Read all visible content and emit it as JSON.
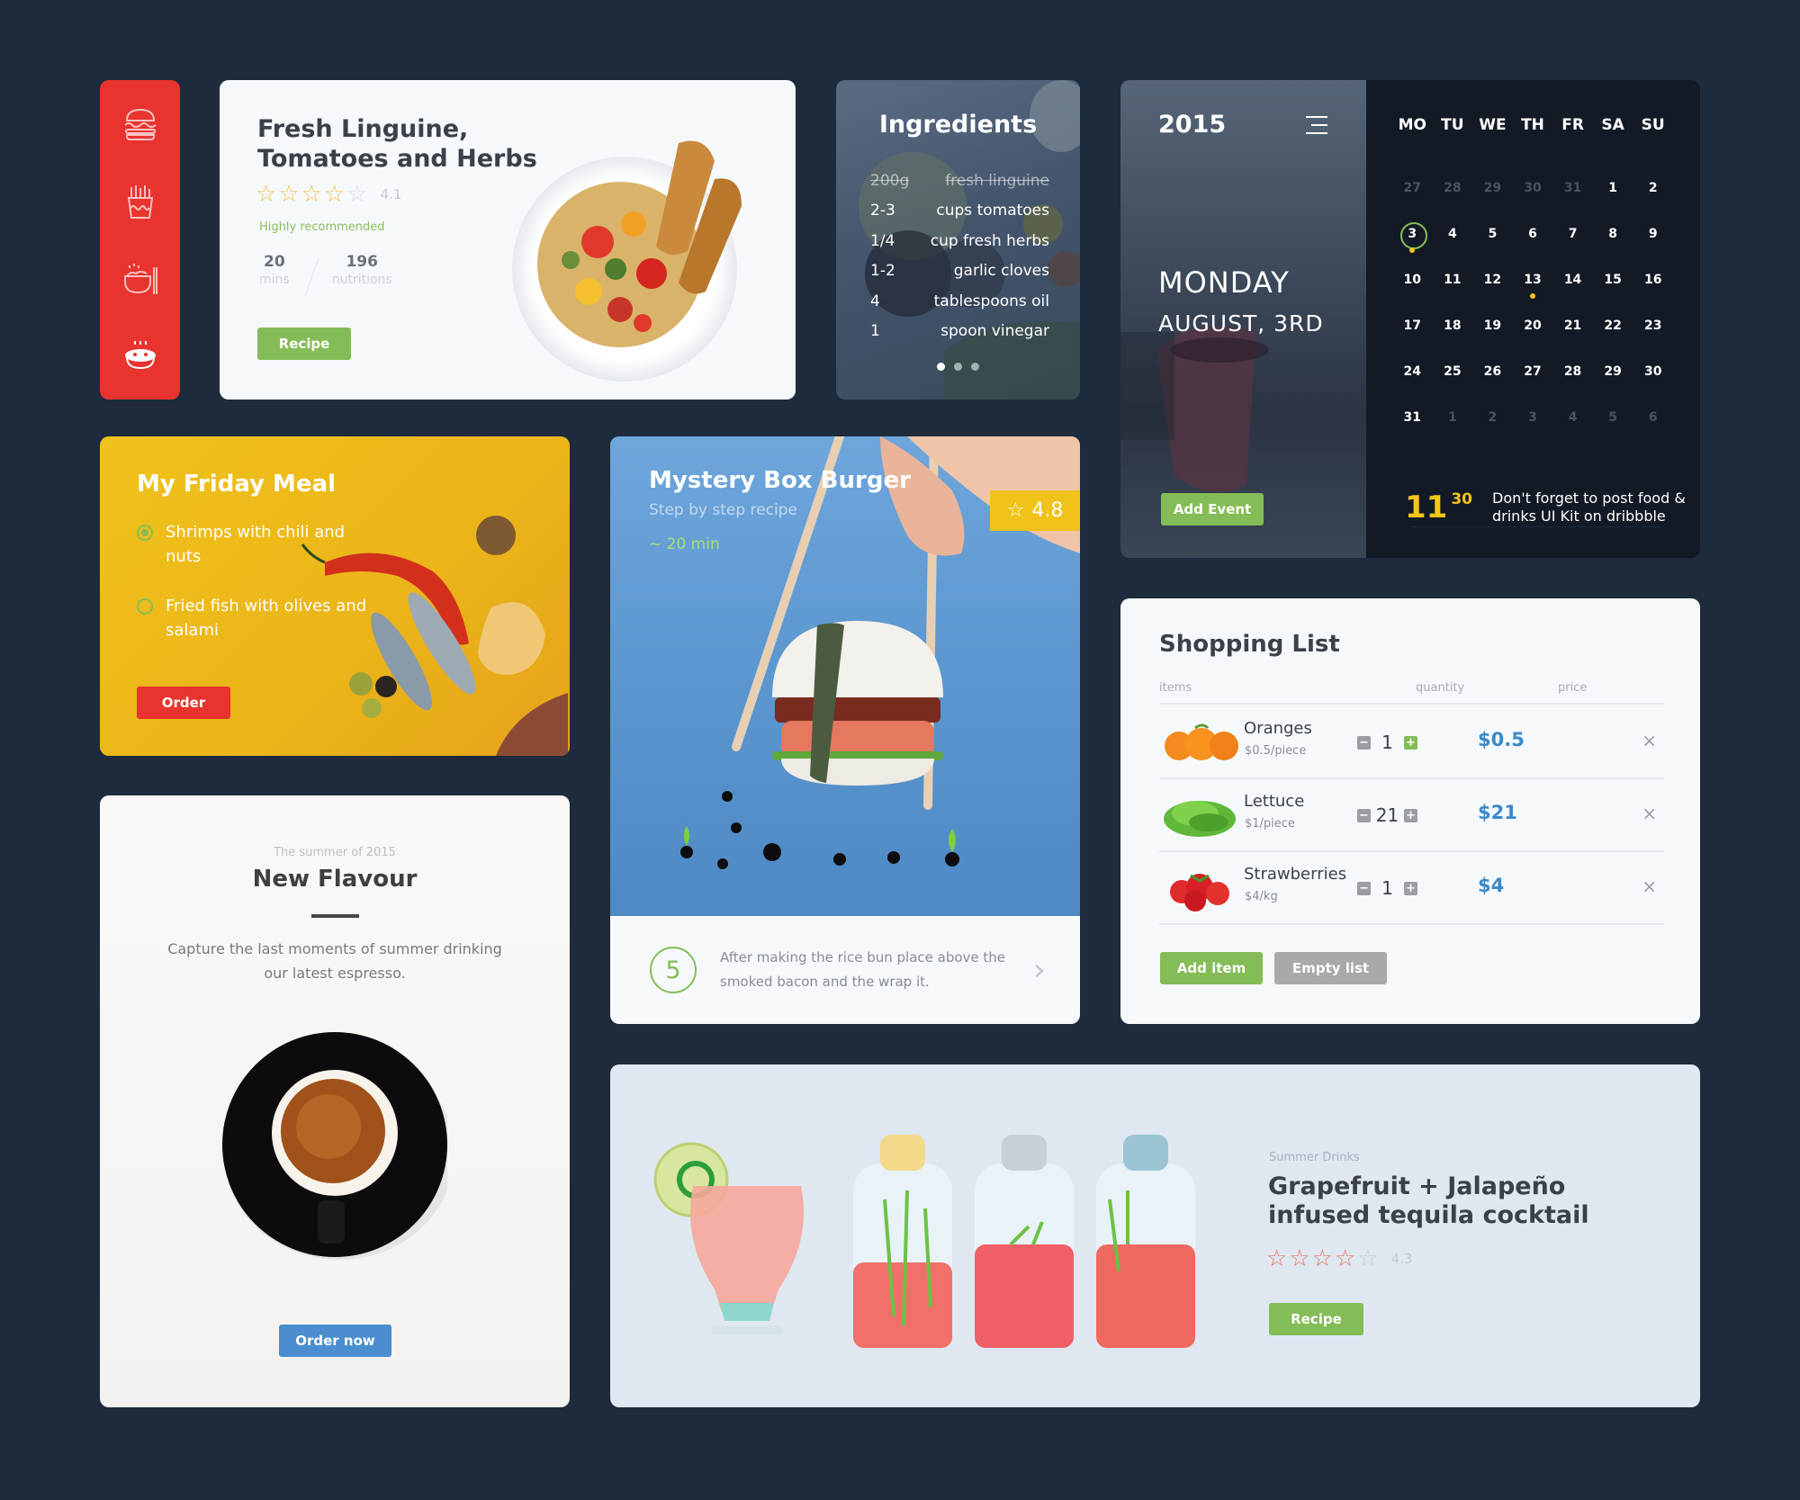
{
  "colors": {
    "background": "#1e2b3c",
    "red": "#e8332e",
    "green": "#84bd57",
    "yellow": "#f0c21a",
    "blue_price": "#3a8ac9",
    "blue_button": "#4a8ed0"
  },
  "sidebar": {
    "items": [
      {
        "icon": "burger-icon",
        "active": false
      },
      {
        "icon": "fries-icon",
        "active": false
      },
      {
        "icon": "noodle-bowl-icon",
        "active": false
      },
      {
        "icon": "hot-dish-icon",
        "active": true
      }
    ]
  },
  "recipe_card": {
    "title": "Fresh Linguine, Tomatoes and Herbs",
    "rating": 4.1,
    "rating_label": "4.1",
    "stars_filled": 4,
    "stars_total": 5,
    "badge": "Highly recommended",
    "stats": [
      {
        "value": "20",
        "label": "mins"
      },
      {
        "value": "196",
        "label": "nutritions"
      }
    ],
    "button": "Recipe"
  },
  "ingredients": {
    "title": "Ingredients",
    "items": [
      {
        "qty": "200g",
        "name": "fresh linguine",
        "done": true
      },
      {
        "qty": "2-3",
        "name": "cups tomatoes",
        "done": false
      },
      {
        "qty": "1/4",
        "name": "cup fresh herbs",
        "done": false
      },
      {
        "qty": "1-2",
        "name": "garlic cloves",
        "done": false
      },
      {
        "qty": "4",
        "name": "tablespoons oil",
        "done": false
      },
      {
        "qty": "1",
        "name": "spoon vinegar",
        "done": false
      }
    ],
    "pages": 3,
    "active_page": 1
  },
  "calendar": {
    "year": "2015",
    "weekday": "MONDAY",
    "date": "AUGUST, 3RD",
    "add_event": "Add Event",
    "days_of_week": [
      "MO",
      "TU",
      "WE",
      "TH",
      "FR",
      "SA",
      "SU"
    ],
    "weeks": [
      [
        {
          "d": "27",
          "m": true
        },
        {
          "d": "28",
          "m": true
        },
        {
          "d": "29",
          "m": true
        },
        {
          "d": "30",
          "m": true
        },
        {
          "d": "31",
          "m": true
        },
        {
          "d": "1"
        },
        {
          "d": "2"
        }
      ],
      [
        {
          "d": "3",
          "today": true,
          "event": true
        },
        {
          "d": "4"
        },
        {
          "d": "5"
        },
        {
          "d": "6"
        },
        {
          "d": "7"
        },
        {
          "d": "8"
        },
        {
          "d": "9"
        }
      ],
      [
        {
          "d": "10"
        },
        {
          "d": "11"
        },
        {
          "d": "12"
        },
        {
          "d": "13",
          "event": true
        },
        {
          "d": "14"
        },
        {
          "d": "15"
        },
        {
          "d": "16"
        }
      ],
      [
        {
          "d": "17"
        },
        {
          "d": "18"
        },
        {
          "d": "19"
        },
        {
          "d": "20"
        },
        {
          "d": "21"
        },
        {
          "d": "22"
        },
        {
          "d": "23"
        }
      ],
      [
        {
          "d": "24"
        },
        {
          "d": "25"
        },
        {
          "d": "26"
        },
        {
          "d": "27"
        },
        {
          "d": "28"
        },
        {
          "d": "29"
        },
        {
          "d": "30"
        }
      ],
      [
        {
          "d": "31"
        },
        {
          "d": "1",
          "m": true
        },
        {
          "d": "2",
          "m": true
        },
        {
          "d": "3",
          "m": true
        },
        {
          "d": "4",
          "m": true
        },
        {
          "d": "5",
          "m": true
        },
        {
          "d": "6",
          "m": true
        }
      ]
    ],
    "reminder": {
      "hour": "11",
      "minute": "30",
      "text": "Don't forget to post food & drinks UI Kit on dribbble"
    }
  },
  "friday_meal": {
    "title": "My Friday Meal",
    "options": [
      {
        "label": "Shrimps  with chili and nuts",
        "selected": true
      },
      {
        "label": "Fried fish with olives and salami",
        "selected": false
      }
    ],
    "button": "Order"
  },
  "burger_card": {
    "title": "Mystery Box Burger",
    "subtitle": "Step by step recipe",
    "time": "~ 20 min",
    "rating": "4.8",
    "step_number": "5",
    "step_text": "After making the rice bun place above the smoked bacon and the wrap it."
  },
  "coffee_card": {
    "kicker": "The summer of 2015",
    "title": "New Flavour",
    "description": "Capture the last moments of summer drinking our latest espresso.",
    "button": "Order now"
  },
  "shopping_list": {
    "title": "Shopping List",
    "columns": [
      "items",
      "quantity",
      "price"
    ],
    "rows": [
      {
        "name": "Oranges",
        "unit": "$0.5/piece",
        "qty": "1",
        "price": "$0.5",
        "image": "oranges",
        "plus_active": true
      },
      {
        "name": "Lettuce",
        "unit": "$1/piece",
        "qty": "21",
        "price": "$21",
        "image": "lettuce",
        "plus_active": false
      },
      {
        "name": "Strawberries",
        "unit": "$4/kg",
        "qty": "1",
        "price": "$4",
        "image": "strawberries",
        "plus_active": false
      }
    ],
    "add_button": "Add item",
    "empty_button": "Empty list"
  },
  "cocktail_card": {
    "kicker": "Summer Drinks",
    "title": "Grapefruit + Jalapeño infused tequila cocktail",
    "rating_label": "4.3",
    "stars_filled": 4,
    "stars_total": 5,
    "button": "Recipe"
  }
}
